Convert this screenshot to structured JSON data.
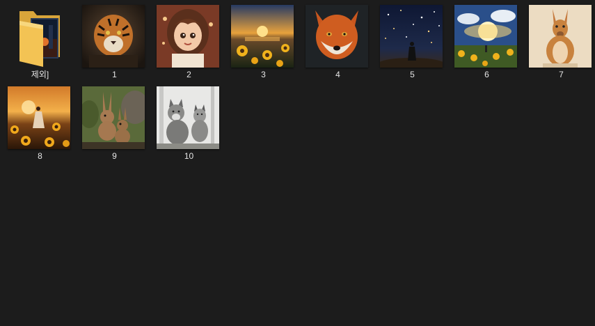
{
  "explorer": {
    "items": [
      {
        "kind": "folder",
        "label": "제외]",
        "icon": "folder-icon",
        "color": "#f3c354"
      },
      {
        "kind": "image",
        "label": "1",
        "icon": "tiger-thumbnail"
      },
      {
        "kind": "image",
        "label": "2",
        "icon": "girl-portrait-thumbnail"
      },
      {
        "kind": "image",
        "label": "3",
        "icon": "sunflower-sunset-thumbnail"
      },
      {
        "kind": "image",
        "label": "4",
        "icon": "fox-thumbnail"
      },
      {
        "kind": "image",
        "label": "5",
        "icon": "starry-night-girl-thumbnail"
      },
      {
        "kind": "image",
        "label": "6",
        "icon": "sunflower-field-sky-thumbnail"
      },
      {
        "kind": "image",
        "label": "7",
        "icon": "kangaroo-thumbnail"
      },
      {
        "kind": "image",
        "label": "8",
        "icon": "girl-sunflowers-thumbnail"
      },
      {
        "kind": "image",
        "label": "9",
        "icon": "rabbits-thumbnail"
      },
      {
        "kind": "image",
        "label": "10",
        "icon": "wolves-thumbnail"
      }
    ]
  },
  "colors": {
    "background": "#1c1c1c",
    "label_text": "#e6e6e6"
  }
}
